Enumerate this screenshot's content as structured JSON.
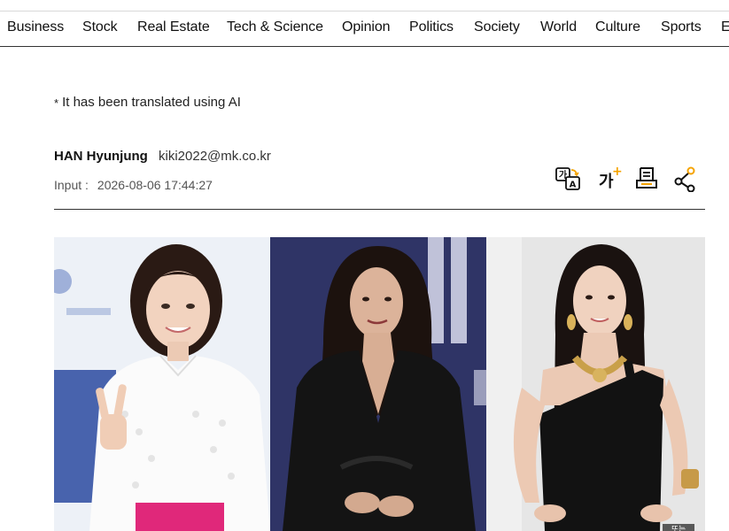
{
  "nav": {
    "items": [
      "Business",
      "Stock",
      "Real Estate",
      "Tech & Science",
      "Opinion",
      "Politics",
      "Society",
      "World",
      "Culture",
      "Sports",
      "E"
    ]
  },
  "article": {
    "ai_note": "It has been translated using AI",
    "ai_note_marker": "*",
    "author": "HAN Hyunjung",
    "email": "kiki2022@mk.co.kr",
    "input_label": "Input :",
    "input_datetime": "2026-08-06 17:44:27"
  },
  "tools": {
    "translate_glyph": "가",
    "translate_glyph_latin": "A",
    "font_size_glyph": "가",
    "font_size_plus": "+",
    "icons": [
      "translate-icon",
      "font-size-icon",
      "print-icon",
      "share-icon"
    ],
    "accent": "#f5a300"
  },
  "photo": {
    "corner_text": "또는"
  }
}
